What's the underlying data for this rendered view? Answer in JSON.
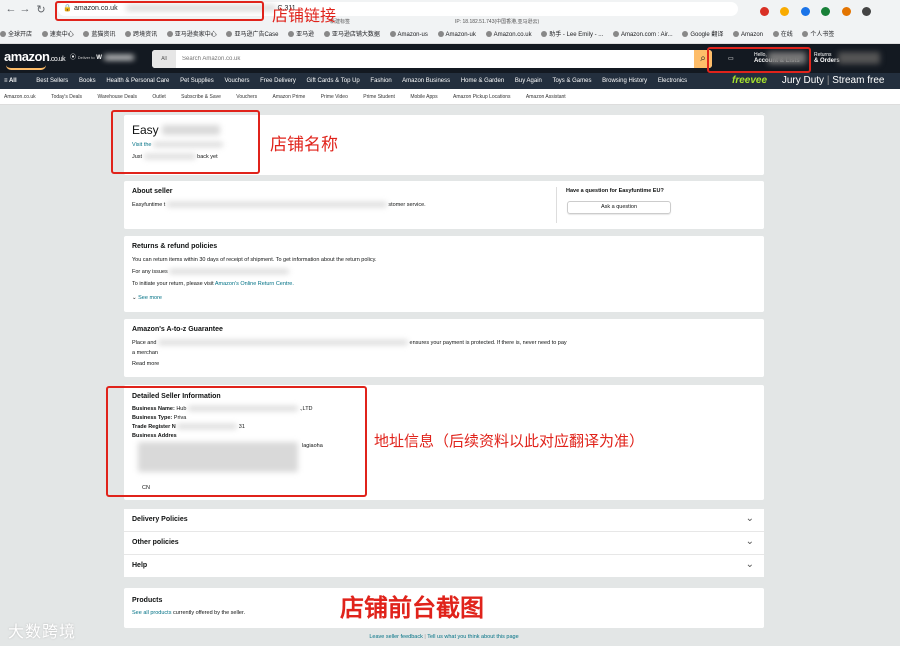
{
  "browser": {
    "url": "amazon.co.uk",
    "url_tail": "C,311",
    "bookmarks": [
      "全球开店",
      "速卖中心",
      "蓝猫资讯",
      "跨境资讯",
      "亚马逊卖家中心",
      "亚马逊广告Case",
      "亚马逊",
      "亚马逊店铺大数据",
      "Amazon-us",
      "Amazon-uk",
      "Amazon.co.uk",
      "助手 - Lee Emily - ...",
      "Amazon.com : Air...",
      "Google 翻译",
      "Amazon",
      "在线",
      "个人书签"
    ],
    "tab_hints": [
      "新建标签",
      "IP: 18.182.51.743(中国香港,亚马逊云)"
    ]
  },
  "amazon": {
    "logo": "amazon",
    "logo_suffix": ".co.uk",
    "deliver_prefix": "Deliver to",
    "deliver_to": "W",
    "search_category": "All",
    "search_placeholder": "Search Amazon.co.uk",
    "hello_line": "Hello,",
    "account_line": "Account & Lists",
    "returns_line1": "Returns",
    "returns_line2": "& Orders",
    "basket": "Basket",
    "nav": [
      "All",
      "Best Sellers",
      "Books",
      "Health & Personal Care",
      "Pet Supplies",
      "Vouchers",
      "Free Delivery",
      "Gift Cards & Top Up",
      "Fashion",
      "Amazon Business",
      "Home & Garden",
      "Buy Again",
      "Toys & Games",
      "Browsing History",
      "Electronics"
    ],
    "promo_brand": "freevee",
    "promo_show": "Jury Duty",
    "promo_cta": "Stream free",
    "subnav": [
      "Amazon.co.uk",
      "Today's Deals",
      "Warehouse Deals",
      "Outlet",
      "Subscribe & Save",
      "Vouchers",
      "Amazon Prime",
      "Prime Video",
      "Prime Student",
      "Mobile Apps",
      "Amazon Pickup Locations",
      "Amazon Assistant"
    ]
  },
  "seller": {
    "name_prefix": "Easy",
    "visit_link": "Visit the",
    "feedback_prefix": "Just",
    "feedback_suffix": "back yet"
  },
  "about": {
    "title": "About seller",
    "text_start": "Easyfuntime t",
    "text_end": "stomer service.",
    "question_title": "Have a question for Easyfuntime EU?",
    "ask_button": "Ask a question"
  },
  "returns": {
    "title": "Returns & refund policies",
    "line1": "You can return items within 30 days of receipt of shipment. To get information about the return policy.",
    "line2": "For any issues",
    "line3_prefix": "To initiate your return, please visit",
    "line3_link": "Amazon's Online Return Centre.",
    "see_more": "See more"
  },
  "guarantee": {
    "title": "Amazon's A-to-z Guarantee",
    "line1_start": "Place and",
    "line1_end": "ensures your payment is protected. If there is, never need to pay",
    "line2": "a merchan",
    "read_more": "Read more"
  },
  "details": {
    "title": "Detailed Seller Information",
    "business_name_label": "Business Name:",
    "business_name_start": "Hub",
    "business_name_end": ".,LTD",
    "business_type_label": "Business Type:",
    "business_type_value": "Priva",
    "trade_register_label": "Trade Register N",
    "trade_register_end": "31",
    "business_address_label": "Business Addres",
    "address_fragment": "lagiaoha",
    "country": "CN"
  },
  "collapsed": [
    "Delivery Policies",
    "Other policies",
    "Help"
  ],
  "products": {
    "title": "Products",
    "link": "See all products",
    "text": "currently offered by the seller."
  },
  "footer": {
    "feedback": "Leave seller feedback",
    "tell_us": "Tell us what you think about this page"
  },
  "annotations": {
    "url": "店铺链接",
    "store_name": "店铺名称",
    "address": "地址信息（后续资料以此对应翻译为准）",
    "screenshot": "店铺前台截图"
  },
  "watermark": "大数跨境",
  "colors": {
    "annotation_red": "#e0231b",
    "amazon_dark": "#131921",
    "amazon_nav": "#232f3e",
    "amazon_orange": "#febd69",
    "link_teal": "#007185",
    "freevee_green": "#a6e22e"
  }
}
